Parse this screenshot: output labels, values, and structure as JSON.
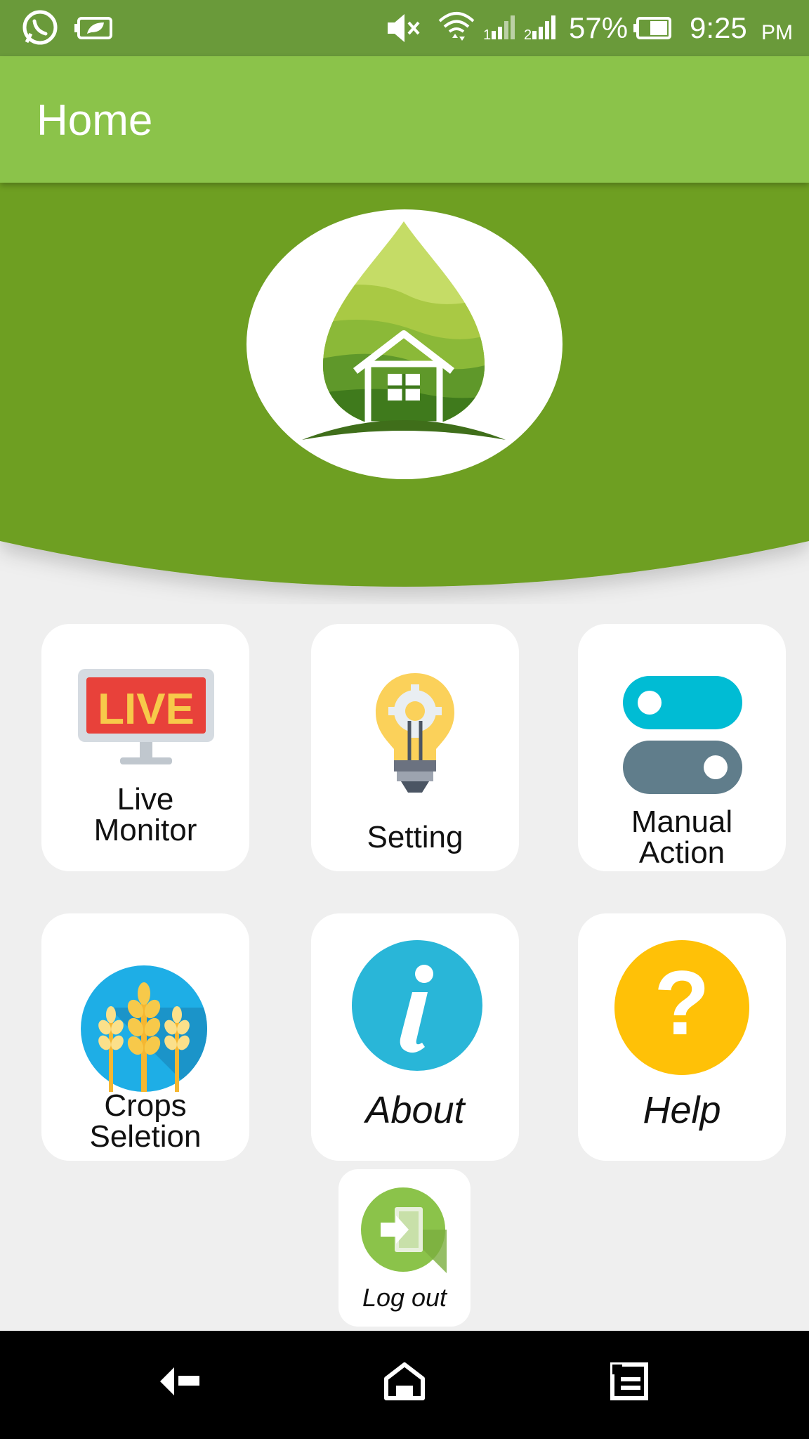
{
  "status_bar": {
    "battery": "57%",
    "time": "9:25",
    "ampm": "PM",
    "icons": [
      "whatsapp-icon",
      "battery-saver-icon",
      "mute-icon",
      "wifi-icon",
      "signal-1-icon",
      "signal-2-icon",
      "battery-icon"
    ]
  },
  "app_bar": {
    "title": "Home"
  },
  "logo": {
    "name": "drop-house-logo",
    "colors": [
      "#c5dc66",
      "#9cc43d",
      "#6aa12e",
      "#3f7a1c"
    ]
  },
  "tiles": [
    {
      "label": "Live\nMonitor",
      "icon": "live-icon",
      "live_text": "LIVE"
    },
    {
      "label": "Setting",
      "icon": "bulb-gear-icon"
    },
    {
      "label": "Manual\nAction",
      "icon": "toggle-switches-icon"
    },
    {
      "label": "Crops\nSeletion",
      "icon": "wheat-icon"
    },
    {
      "label": "About",
      "icon": "info-icon",
      "glyph": "i"
    },
    {
      "label": "Help",
      "icon": "help-icon",
      "glyph": "?"
    }
  ],
  "logout": {
    "label": "Log out",
    "icon": "logout-icon"
  },
  "nav": {
    "icons": [
      "back-icon",
      "home-icon",
      "recents-icon"
    ]
  },
  "colors": {
    "status_bar": "#6a9a3a",
    "app_bar": "#8bc34a",
    "hero": "#6e9f22",
    "background": "#efefef"
  }
}
